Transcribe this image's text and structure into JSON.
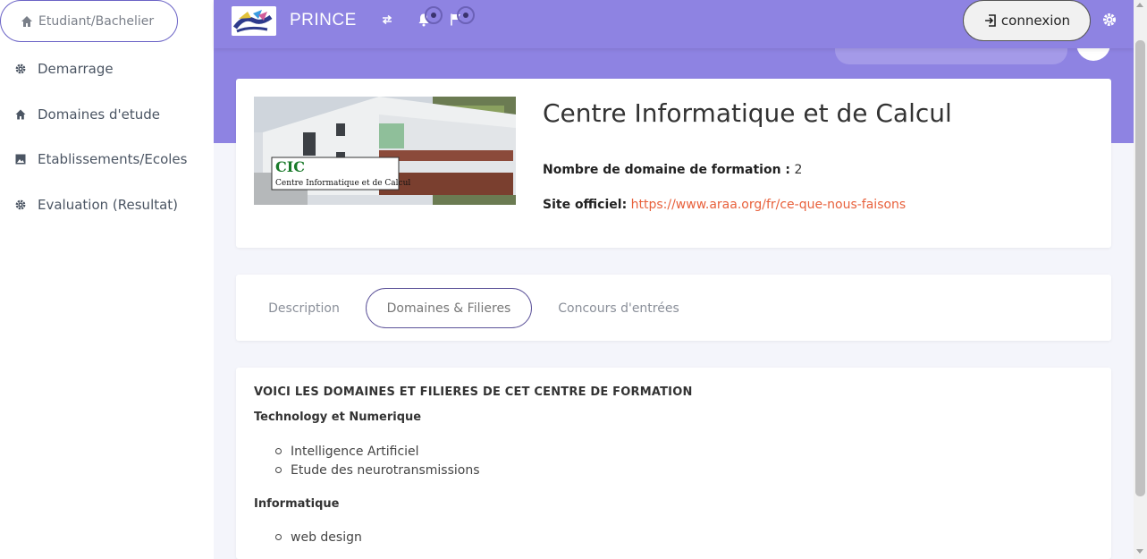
{
  "sidebar": {
    "top_pill": {
      "label": "Etudiant/Bachelier",
      "icon": "home-icon"
    },
    "items": [
      {
        "label": "Demarrage",
        "icon": "gear-icon"
      },
      {
        "label": "Domaines d'etude",
        "icon": "home-icon"
      },
      {
        "label": "Etablissements/Ecoles",
        "icon": "image-icon"
      },
      {
        "label": "Evaluation (Resultat)",
        "icon": "gear-icon"
      }
    ]
  },
  "header": {
    "brand": "PRINCE",
    "connexion_label": "connexion",
    "icons": [
      "swap-icon",
      "bell-icon",
      "flag-icon",
      "login-icon",
      "gear-icon"
    ],
    "accent_color": "#8e83e2"
  },
  "school": {
    "title": "Centre Informatique et de Calcul",
    "image_caption_short": "CIC",
    "image_caption_long": "Centre Informatique et de Calcul",
    "domain_count_label": "Nombre de domaine de formation :",
    "domain_count_value": "2",
    "site_label": "Site officiel:",
    "site_url": "https://www.araa.org/fr/ce-que-nous-faisons",
    "link_color": "#e8613c"
  },
  "tabs": [
    {
      "label": "Description",
      "active": false
    },
    {
      "label": "Domaines & Filieres",
      "active": true
    },
    {
      "label": "Concours d'entrées",
      "active": false
    }
  ],
  "domains": {
    "heading": "VOICI LES DOMAINES ET FILIERES DE CET CENTRE DE FORMATION",
    "groups": [
      {
        "name": "Technology et Numerique",
        "items": [
          "Intelligence Artificiel",
          "Etude des neurotransmissions"
        ]
      },
      {
        "name": "Informatique",
        "items": [
          "web design"
        ]
      }
    ]
  }
}
